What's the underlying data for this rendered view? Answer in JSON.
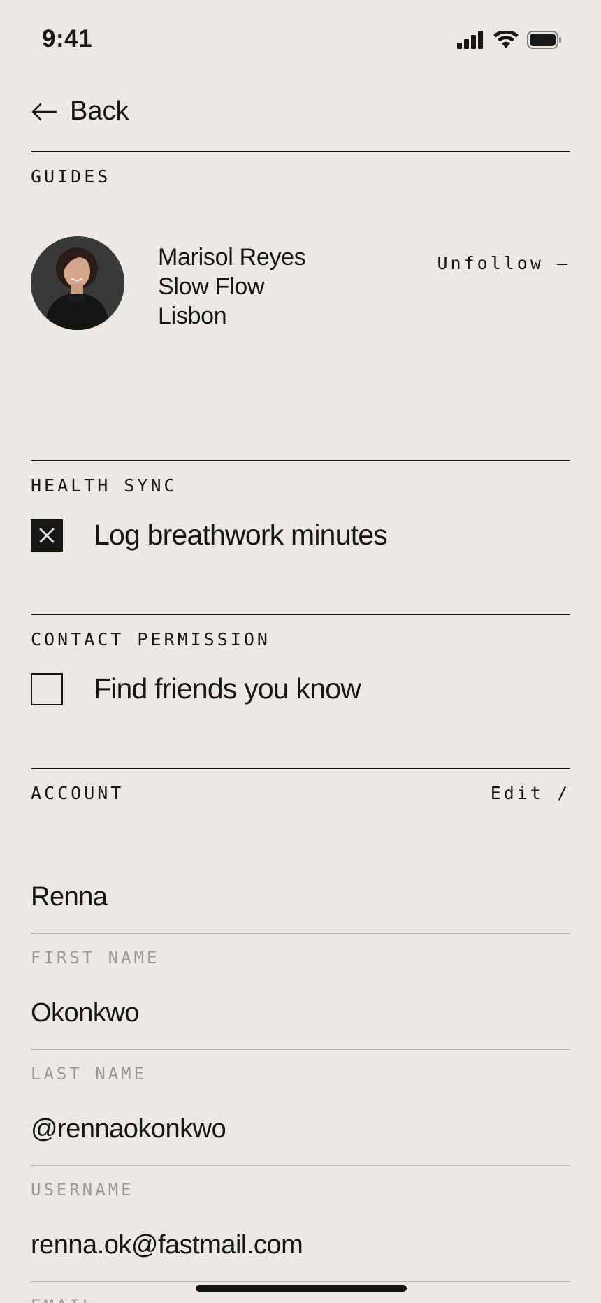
{
  "status_bar": {
    "time": "9:41"
  },
  "nav": {
    "back_label": "Back"
  },
  "guides": {
    "section_label": "GUIDES",
    "guide": {
      "name": "Marisol Reyes",
      "style": "Slow Flow",
      "city": "Lisbon"
    },
    "unfollow_label": "Unfollow –"
  },
  "health_sync": {
    "section_label": "HEALTH SYNC",
    "option_label": "Log breathwork minutes",
    "checked": true
  },
  "contact_permission": {
    "section_label": "CONTACT PERMISSION",
    "option_label": "Find friends you know",
    "checked": false
  },
  "account": {
    "section_label": "ACCOUNT",
    "edit_label": "Edit /",
    "fields": [
      {
        "value": "Renna",
        "caption": "FIRST NAME"
      },
      {
        "value": "Okonkwo",
        "caption": "LAST NAME"
      },
      {
        "value": "@rennaokonkwo",
        "caption": "USERNAME"
      },
      {
        "value": "renna.ok@fastmail.com",
        "caption": "EMAIL"
      }
    ]
  }
}
